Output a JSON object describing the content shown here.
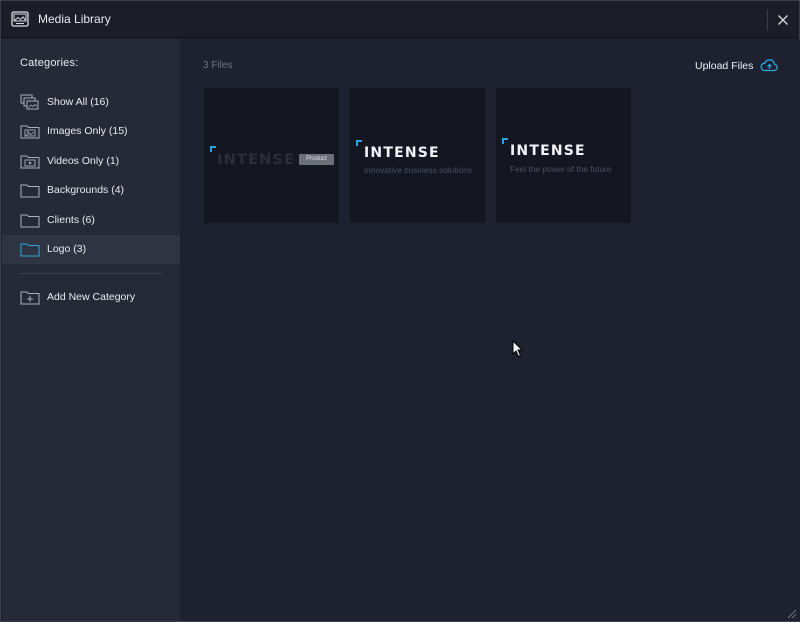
{
  "window": {
    "title": "Media Library"
  },
  "sidebar": {
    "heading": "Categories:",
    "items": [
      {
        "label": "Show All (16)",
        "icon": "gallery-icon"
      },
      {
        "label": "Images Only (15)",
        "icon": "image-folder-icon"
      },
      {
        "label": "Videos Only (1)",
        "icon": "video-folder-icon"
      },
      {
        "label": "Backgrounds (4)",
        "icon": "folder-icon"
      },
      {
        "label": "Clients (6)",
        "icon": "folder-icon"
      },
      {
        "label": "Logo (3)",
        "icon": "folder-icon",
        "active": true
      }
    ],
    "add_category": "Add New Category"
  },
  "main": {
    "file_count": "3 Files",
    "upload_label": "Upload Files",
    "thumbnails": [
      {
        "logo_text": "INTENSE",
        "subtitle": "",
        "badge": "Product"
      },
      {
        "logo_text": "INTENSE",
        "subtitle": "Innovative business solutions",
        "badge": ""
      },
      {
        "logo_text": "INTENSE",
        "subtitle": "Feel the power of the future",
        "badge": ""
      }
    ]
  },
  "colors": {
    "accent": "#2aa6e0",
    "background": "#1e2230",
    "sidebar": "#262a37",
    "active_item": "#2f3443"
  }
}
